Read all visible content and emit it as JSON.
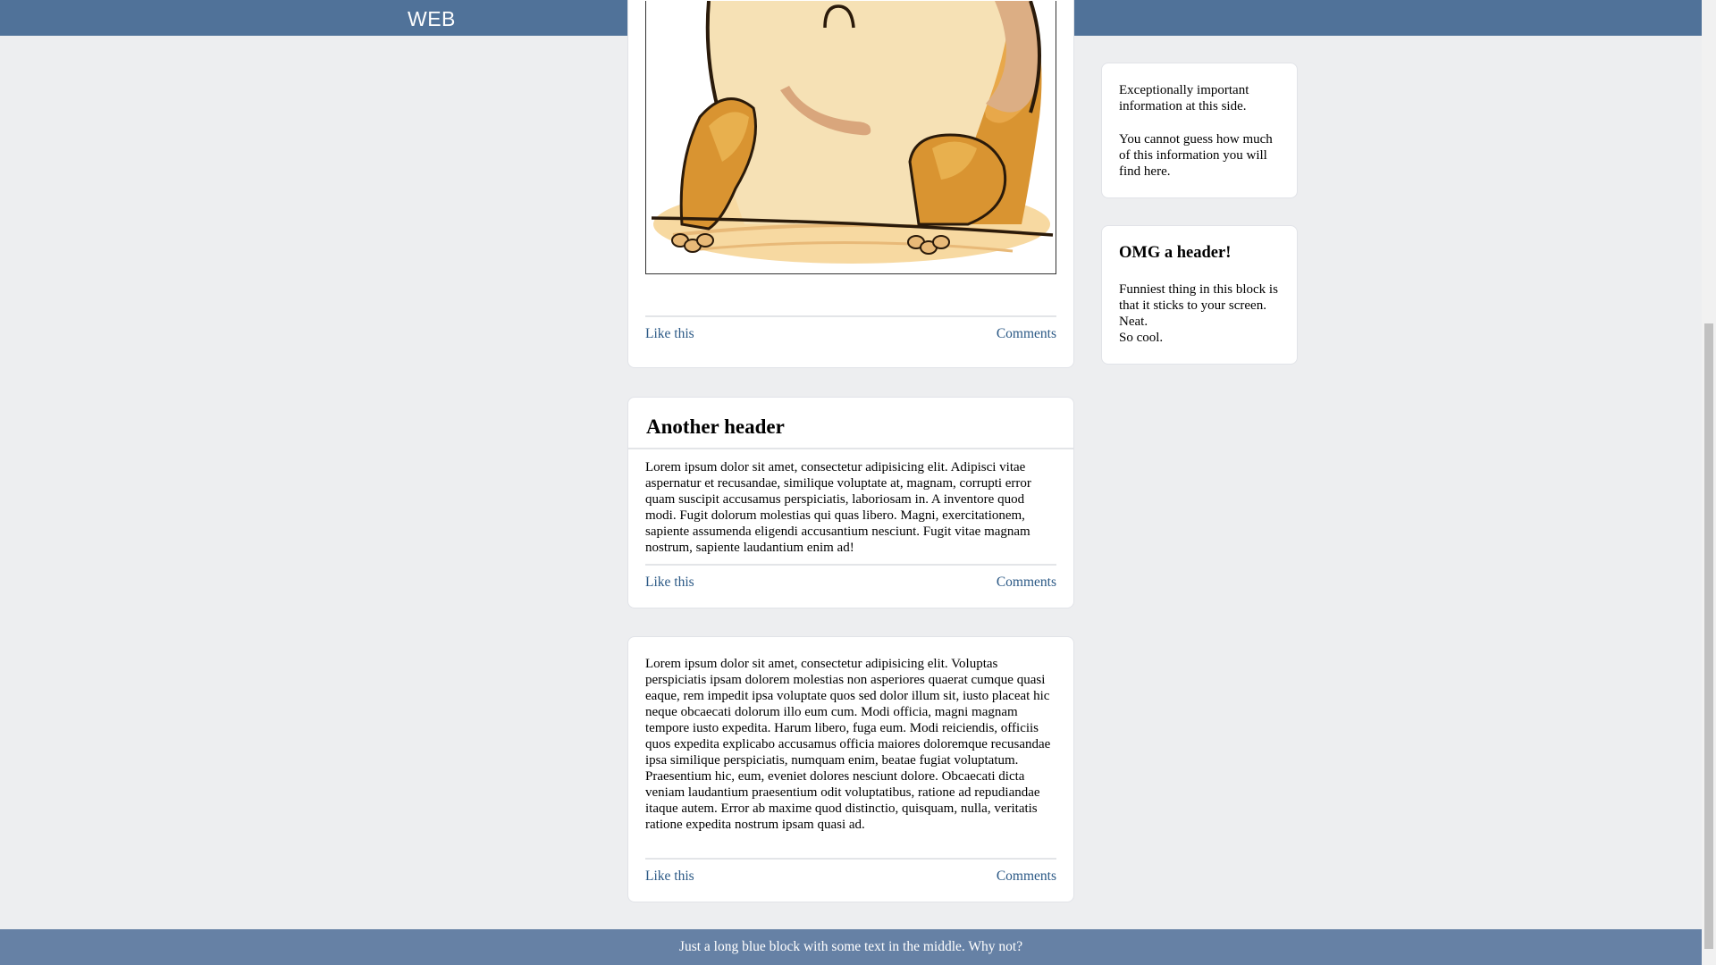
{
  "header": {
    "logo": "WEB"
  },
  "posts": [
    {
      "like_label": "Like this",
      "comments_label": "Comments"
    },
    {
      "title": "Another header",
      "text": "Lorem ipsum dolor sit amet, consectetur adipisicing elit. Adipisci vitae aspernatur et recusandae, similique voluptate at, magnam, corrupti error quam suscipit accusamus perspiciatis, laboriosam in. A inventore quod modi. Fugit dolorum molestias qui quas libero. Magni, exercitationem, sapiente assumenda eligendi accusantium nesciunt. Fugit vitae magnam nostrum, sapiente laudantium enim ad!",
      "like_label": "Like this",
      "comments_label": "Comments"
    },
    {
      "text": "Lorem ipsum dolor sit amet, consectetur adipisicing elit. Voluptas perspiciatis ipsam dolorem molestias non asperiores quaerat cumque quasi eaque, rem impedit ipsa voluptate quos sed dolor illum sit, iusto placeat hic neque obcaecati dolorum illo eum cum. Modi officia, magni magnam tempore iusto expedita. Harum libero, fuga eum. Modi reiciendis, officiis quos expedita explicabo accusamus officia maiores doloremque recusandae ipsa similique perspiciatis, numquam enim, beatae fugiat voluptatum. Praesentium hic, eum, eveniet dolores nesciunt dolore. Obcaecati dicta veniam laudantium praesentium odit voluptatibus, ratione ad repudiandae itaque autem. Error ab maxime quod distinctio, quisquam, nulla, veritatis ratione expedita nostrum ipsam quasi ad.",
      "like_label": "Like this",
      "comments_label": "Comments"
    }
  ],
  "sidebar": {
    "info_block": {
      "line1": "Exceptionally important information at this side.",
      "line2": "You cannot guess how much of this information you will find here."
    },
    "sticky_block": {
      "title": "OMG a header!",
      "line1": "Funniest thing in this block is that it sticks to your screen. Neat.",
      "line2": "So cool."
    }
  },
  "footer": {
    "text": "Just a long blue block with some text in the middle. Why not?"
  },
  "colors": {
    "topbar": "#507299",
    "footer": "#6681a5",
    "link": "#2a5885",
    "background": "#edeef0"
  }
}
